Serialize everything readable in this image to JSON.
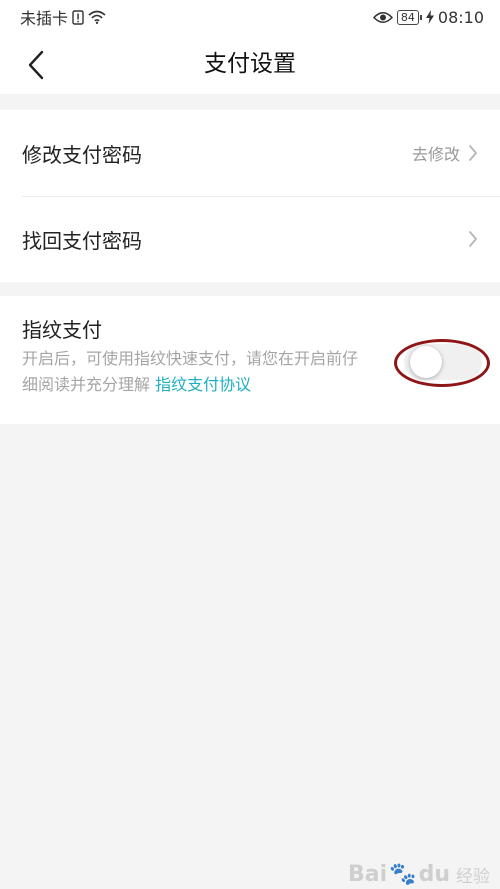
{
  "status_bar": {
    "carrier": "未插卡",
    "battery": "84",
    "time": "08:10",
    "icons": [
      "sim-alert-icon",
      "wifi-icon",
      "eye-icon",
      "battery-icon",
      "charging-icon"
    ]
  },
  "header": {
    "title": "支付设置",
    "back_icon": "chevron-left-icon"
  },
  "settings": {
    "modify_password": {
      "label": "修改支付密码",
      "action": "去修改"
    },
    "recover_password": {
      "label": "找回支付密码"
    }
  },
  "fingerprint": {
    "title": "指纹支付",
    "desc_line1": "开启后，可使用指纹快速支付，请您在开启前仔",
    "desc_line2": "细阅读并充分理解 ",
    "link": "指纹支付协议",
    "enabled": false
  },
  "watermark": {
    "brand": "Bai",
    "paw": "🐾",
    "suffix": "du",
    "sub": "经验"
  },
  "colors": {
    "link": "#1fb0bf",
    "highlight": "#8e1616",
    "background": "#f4f4f4"
  }
}
